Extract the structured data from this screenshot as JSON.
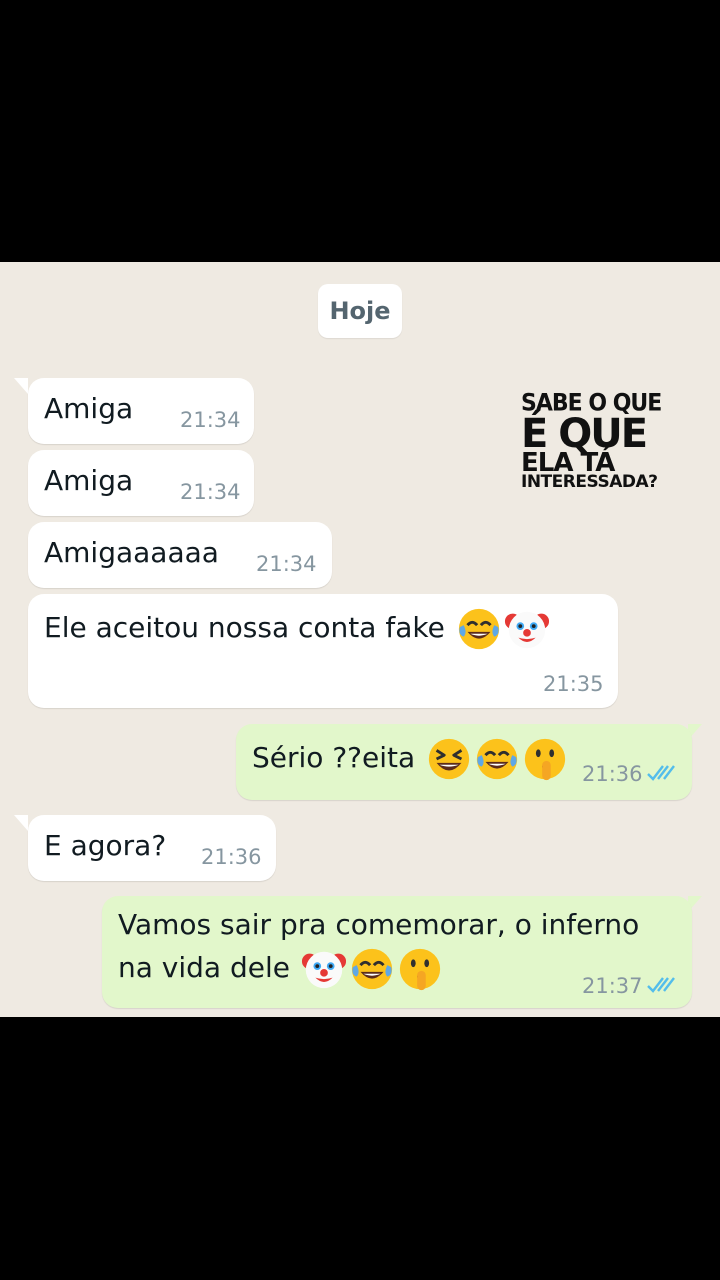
{
  "chat": {
    "date_label": "Hoje",
    "messages": [
      {
        "dir": "in",
        "text": "Amiga",
        "time": "21:34"
      },
      {
        "dir": "in",
        "text": "Amiga",
        "time": "21:34"
      },
      {
        "dir": "in",
        "text": "Amigaaaaaa",
        "time": "21:34"
      },
      {
        "dir": "in",
        "text": "Ele aceitou nossa conta fake",
        "time": "21:35",
        "emojis": [
          "tears-of-joy-emoji",
          "clown-emoji"
        ]
      },
      {
        "dir": "out",
        "text": "Sério ??eita",
        "time": "21:36",
        "emojis": [
          "grinning-squinting-emoji",
          "tears-of-joy-emoji",
          "shushing-emoji"
        ],
        "read": true
      },
      {
        "dir": "in",
        "text": "E agora?",
        "time": "21:36"
      },
      {
        "dir": "out",
        "text_line1": "Vamos sair pra comemorar, o inferno",
        "text_line2": "na vida dele",
        "time": "21:37",
        "emojis": [
          "clown-emoji",
          "tears-of-joy-emoji",
          "shushing-emoji"
        ],
        "read": true
      }
    ]
  },
  "overlay": {
    "line1": "SABE O QUE",
    "line2": "É QUE",
    "line3": "ELA TÁ",
    "line4": "INTERESSADA?"
  },
  "colors": {
    "chat_background": "#efeae2",
    "incoming_bubble": "#ffffff",
    "outgoing_bubble": "#e2f7cb",
    "read_checks": "#53bdeb",
    "timestamp": "#8696a0"
  }
}
